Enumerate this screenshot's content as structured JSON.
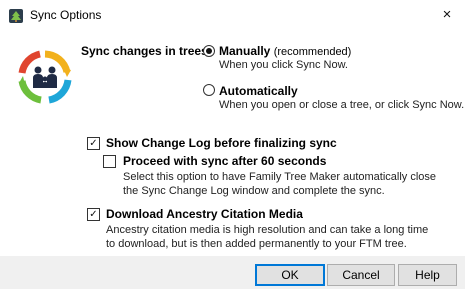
{
  "window": {
    "title": "Sync Options",
    "close_glyph": "×"
  },
  "icons": {
    "title": "family-tree-maker-icon",
    "logo": "sync-family-icon",
    "close": "close-icon"
  },
  "sync": {
    "label": "Sync changes in trees:",
    "manual": {
      "label": "Manually",
      "note": "(recommended)",
      "desc": "When you click Sync Now.",
      "selected": true
    },
    "auto": {
      "label": "Automatically",
      "desc": "When you open or close a tree, or click Sync Now.",
      "selected": false
    }
  },
  "change_log": {
    "label": "Show Change Log before finalizing sync",
    "checked": true,
    "proceed": {
      "label": "Proceed with sync after 60 seconds",
      "checked": false,
      "desc_line1": "Select this option to have Family Tree Maker automatically close",
      "desc_line2": "the Sync Change Log window and complete the sync."
    }
  },
  "media": {
    "label": "Download Ancestry Citation Media",
    "checked": true,
    "desc_line1": "Ancestry citation media is high resolution and can take a long time",
    "desc_line2": "to download, but is then added permanently to your FTM tree."
  },
  "buttons": {
    "ok": "OK",
    "cancel": "Cancel",
    "help": "Help"
  },
  "check_glyph": "✓",
  "colors": {
    "footer": "#f0f0f0",
    "default_button_border": "#0078d7"
  }
}
